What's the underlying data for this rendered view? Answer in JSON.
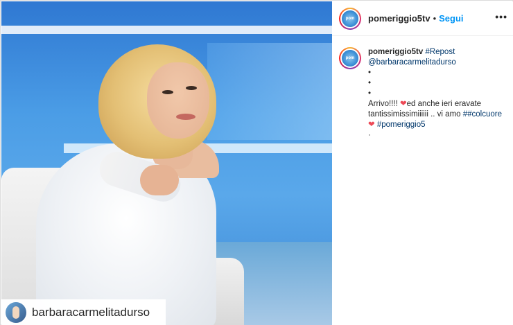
{
  "post": {
    "photo_tag": {
      "username": "barbaracarmelitadurso"
    }
  },
  "header": {
    "username": "pomeriggio5tv",
    "separator": "•",
    "follow_label": "Segui",
    "more_label": "•••",
    "avatar_text": "pom"
  },
  "caption": {
    "username": "pomeriggio5tv",
    "hashtag_repost": "#Repost",
    "mention": "@barbaracarmelitadurso",
    "bullets": [
      "•",
      "•",
      "•"
    ],
    "text_1": "Arrivo!!!! ",
    "heart_1": "❤",
    "text_2": "ed anche ieri eravate tantissimissimiiiiii .. vi amo ",
    "hashtag_colcuore": "##colcuore",
    "heart_2": "❤",
    "hashtag_pomeriggio5": " #pomeriggio5",
    "trailing": "·"
  },
  "colors": {
    "link_blue": "#0095f6",
    "mention_blue": "#00376b",
    "heart_red": "#ed4956"
  }
}
